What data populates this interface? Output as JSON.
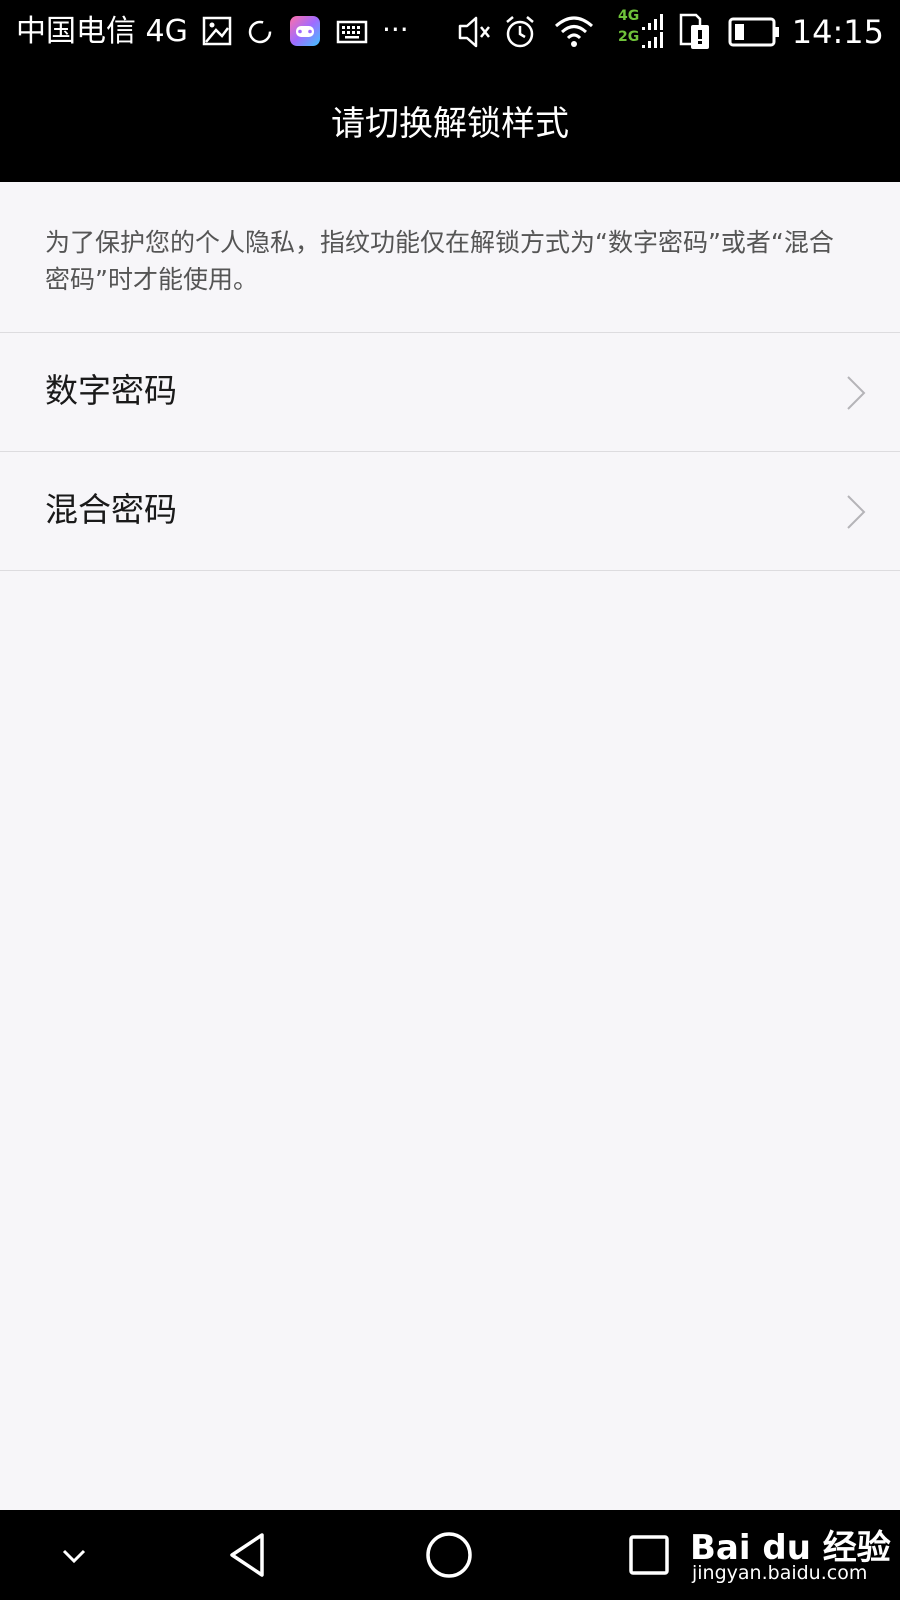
{
  "status_bar": {
    "carrier": "中国电信 4G",
    "overflow": "···",
    "network_top": "4G",
    "network_bottom": "2G",
    "time": "14:15"
  },
  "header": {
    "title": "请切换解锁样式"
  },
  "notice": {
    "text": "为了保护您的个人隐私，指纹功能仅在解锁方式为“数字密码”或者“混合密码”时才能使用。"
  },
  "options": [
    {
      "label": "数字密码"
    },
    {
      "label": "混合密码"
    }
  ],
  "watermark": {
    "brand": "Bai du 经验",
    "url": "jingyan.baidu.com"
  },
  "colors": {
    "background": "#f7f6f9",
    "bar": "#000000",
    "divider": "#dddcdf",
    "network_accent": "#6fc23a"
  }
}
